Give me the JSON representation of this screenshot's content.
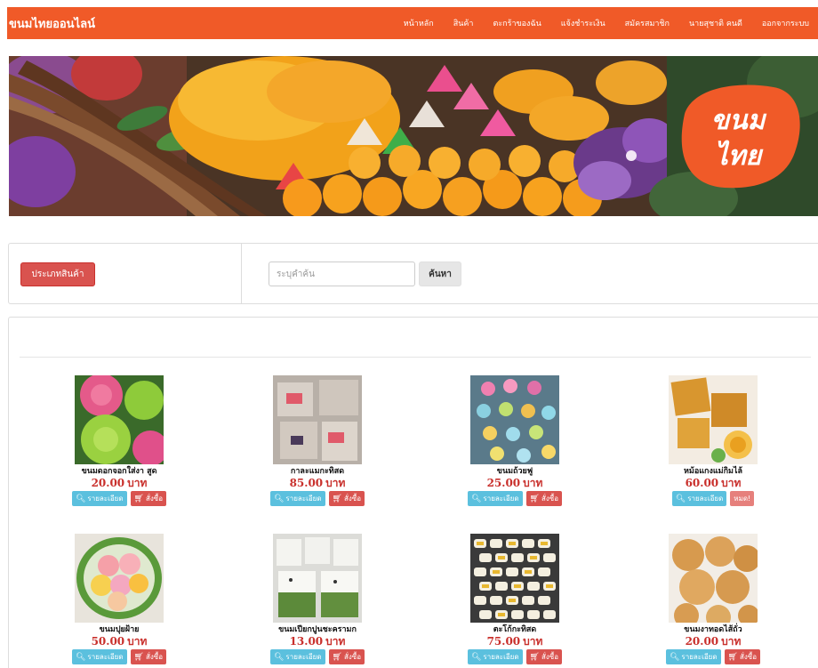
{
  "navbar": {
    "brand": "ขนมไทยออนไลน์",
    "links": [
      "หน้าหลัก",
      "สินค้า",
      "ตะกร้าของฉัน",
      "แจ้งชำระเงิน",
      "สมัครสมาชิก",
      "นายสุชาติ คนดี",
      "ออกจากระบบ"
    ]
  },
  "banner": {
    "logo_text_line1": "ขนม",
    "logo_text_line2": "ไทย"
  },
  "search": {
    "category_button": "ประเภทสินค้า",
    "placeholder": "ระบุคำค้น",
    "search_button": "ค้นหา"
  },
  "actions": {
    "detail": "รายละเอียด",
    "order": "สั่งซื้อ",
    "sold_out": "หมด!"
  },
  "products": [
    {
      "name": "ขนมดอกจอกใส่งา สูด",
      "price": "20.00",
      "unit": "บาท",
      "status": "available"
    },
    {
      "name": "กาละแมกะทิสด",
      "price": "85.00",
      "unit": "บาท",
      "status": "available"
    },
    {
      "name": "ขนมถ้วยฟู",
      "price": "25.00",
      "unit": "บาท",
      "status": "available"
    },
    {
      "name": "หม้อแกงแม่กิมไล้",
      "price": "60.00",
      "unit": "บาท",
      "status": "sold_out"
    },
    {
      "name": "ขนมปุยฝ้าย",
      "price": "50.00",
      "unit": "บาท",
      "status": "available"
    },
    {
      "name": "ขนมเปียกปูนชะครามก",
      "price": "13.00",
      "unit": "บาท",
      "status": "available"
    },
    {
      "name": "ตะโก้กะทิสด",
      "price": "75.00",
      "unit": "บาท",
      "status": "available"
    },
    {
      "name": "ขนมงาทอดไส้ถั่ว",
      "price": "20.00",
      "unit": "บาท",
      "status": "available"
    }
  ],
  "colors": {
    "navbar": "#f05a28",
    "danger": "#d9534f",
    "info": "#5bc0de",
    "price": "#c9302c"
  },
  "icons": {
    "detail": "search-icon",
    "order": "cart-icon"
  }
}
